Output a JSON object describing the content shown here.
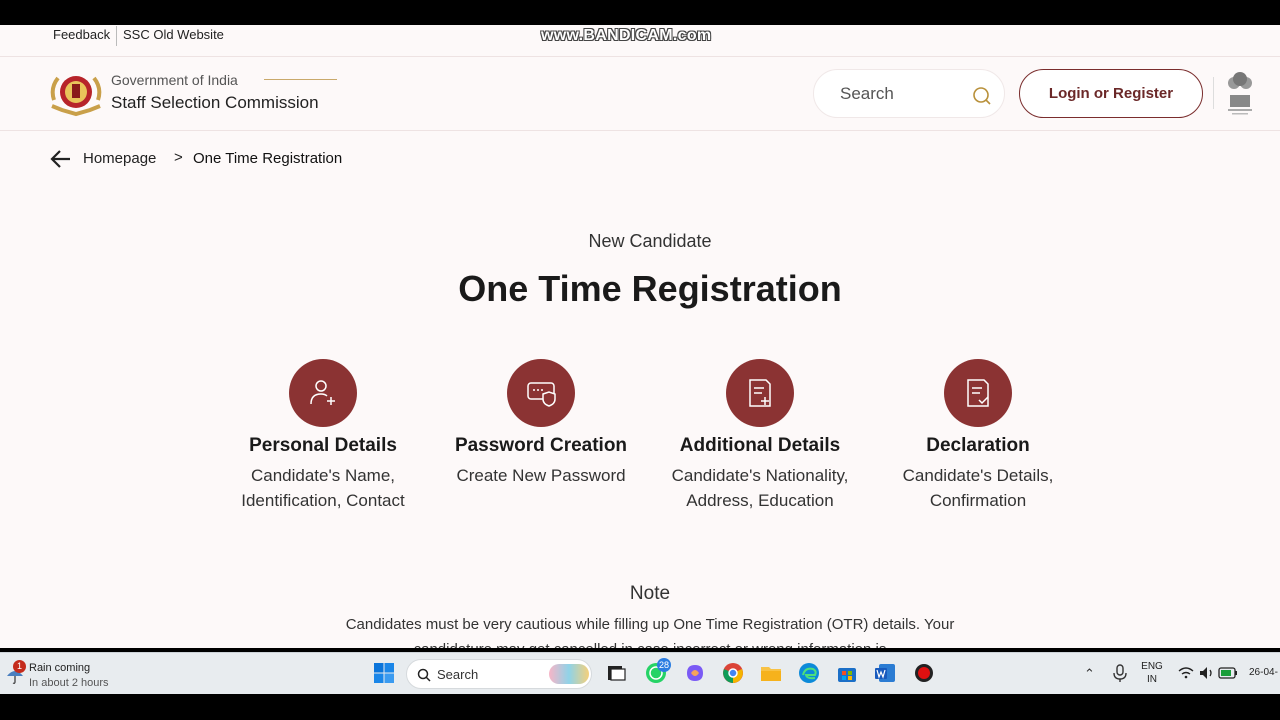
{
  "top_links": {
    "feedback": "Feedback",
    "old_site": "SSC Old Website"
  },
  "watermark": "www.BANDICAM.com",
  "header": {
    "gov": "Government of India",
    "org": "Staff Selection Commission",
    "search_placeholder": "Search",
    "login_label": "Login or Register"
  },
  "breadcrumb": {
    "home": "Homepage",
    "separator": ">",
    "current": "One Time Registration"
  },
  "hero": {
    "subtitle": "New Candidate",
    "title": "One Time Registration"
  },
  "steps": [
    {
      "name": "Personal Details",
      "desc": "Candidate's Name, Identification, Contact",
      "icon": "user-plus-icon"
    },
    {
      "name": "Password Creation",
      "desc": "Create New Password",
      "icon": "password-shield-icon"
    },
    {
      "name": "Additional Details",
      "desc": "Candidate's Nationality, Address, Education",
      "icon": "document-plus-icon"
    },
    {
      "name": "Declaration",
      "desc": "Candidate's Details, Confirmation",
      "icon": "document-check-icon"
    }
  ],
  "note": {
    "title": "Note",
    "text": "Candidates must be very cautious while filling up One Time Registration (OTR) details. Your candidature may get cancelled in case incorrect or wrong information is"
  },
  "taskbar": {
    "weather_title": "Rain coming",
    "weather_sub": "In about 2 hours",
    "weather_badge": "1",
    "search_label": "Search",
    "whatsapp_badge": "28",
    "lang_top": "ENG",
    "lang_bottom": "IN",
    "date": "26-04-"
  },
  "colors": {
    "accent": "#8b3333",
    "page_bg": "#fdf9f9"
  }
}
